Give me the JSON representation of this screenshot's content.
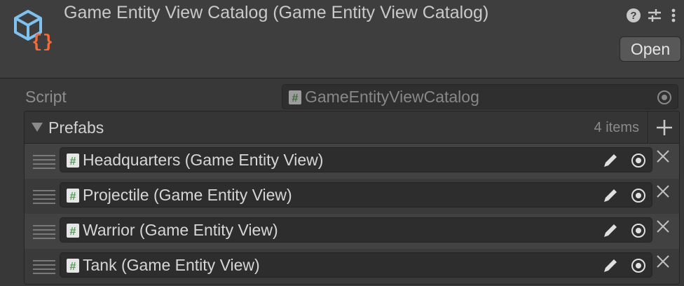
{
  "header": {
    "title": "Game Entity View Catalog (Game Entity View Catalog)",
    "open_label": "Open",
    "asset_icon": "scriptable-object-cube-icon",
    "help_icon": "help-icon",
    "settings_icon": "sliders-icon",
    "more_icon": "kebab-menu-icon"
  },
  "script": {
    "label": "Script",
    "value": "GameEntityViewCatalog"
  },
  "list": {
    "label": "Prefabs",
    "count": "4 items",
    "items": [
      {
        "label": "Headquarters (Game Entity View)"
      },
      {
        "label": "Projectile (Game Entity View)"
      },
      {
        "label": "Warrior (Game Entity View)"
      },
      {
        "label": "Tank (Game Entity View)"
      }
    ]
  },
  "colors": {
    "accent_orange": "#f26c3b",
    "accent_blue": "#7fc2f0",
    "script_icon_green": "#4fa04f"
  }
}
